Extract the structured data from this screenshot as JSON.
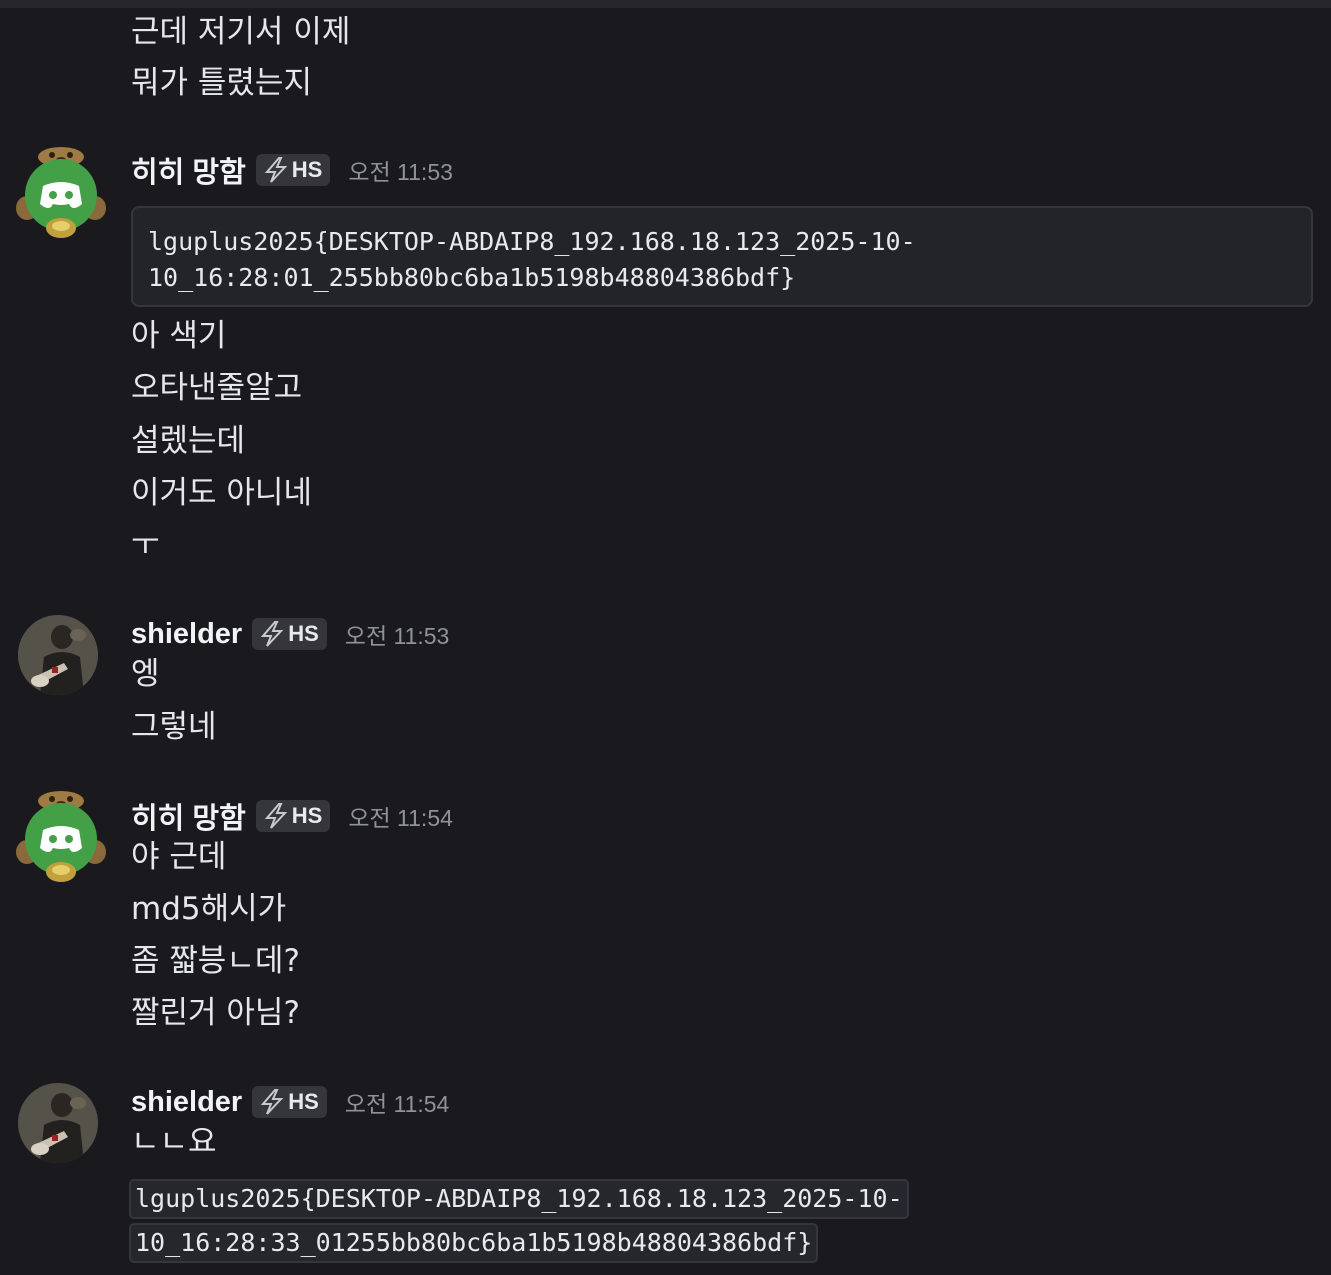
{
  "messages": [
    {
      "lines": [
        "근데 저기서 이제",
        "뭐가 틀렸는지"
      ]
    },
    {
      "author": "히히 망함",
      "badge": "HS",
      "time": "오전 11:53",
      "avatar": "discord-bear-avatar",
      "code_block": [
        "lguplus2025{DESKTOP-ABDAIP8_192.168.18.123_2025-10-",
        "10_16:28:01_255bb80bc6ba1b5198b48804386bdf}"
      ],
      "lines": [
        "아 색기",
        "오타낸줄알고",
        "설렜는데",
        "이거도 아니네",
        "ㅜ"
      ]
    },
    {
      "author": "shielder",
      "badge": "HS",
      "time": "오전 11:53",
      "avatar": "guitarist-photo-avatar",
      "lines": [
        "엥",
        "그렇네"
      ]
    },
    {
      "author": "히히 망함",
      "badge": "HS",
      "time": "오전 11:54",
      "avatar": "discord-bear-avatar",
      "lines": [
        "야 근데",
        "md5해시가",
        "좀 짧븡ㄴ데?",
        "짤린거 아님?"
      ]
    },
    {
      "author": "shielder",
      "badge": "HS",
      "time": "오전 11:54",
      "avatar": "guitarist-photo-avatar",
      "lines": [
        "ㄴㄴ요"
      ],
      "inline_code": [
        "lguplus2025{DESKTOP-ABDAIP8_192.168.18.123_2025-10-",
        "10_16:28:33_01255bb80bc6ba1b5198b48804386bdf}"
      ]
    }
  ],
  "colors": {
    "background": "#1a1a1e",
    "text": "#dbdee1",
    "timestamp": "#8f9299",
    "badge_bg": "#35363c",
    "code_bg": "#232428",
    "discord_green": "#4caf50"
  }
}
